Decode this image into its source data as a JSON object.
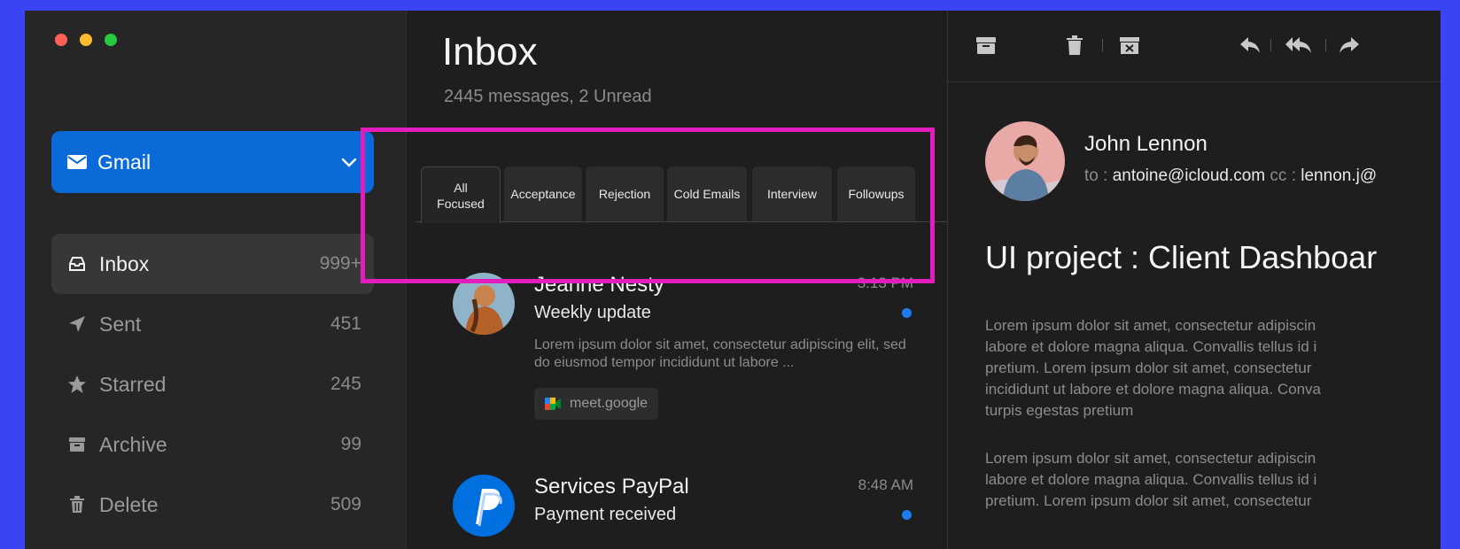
{
  "colors": {
    "background": "#3a44f5",
    "accent": "#0a6bd8",
    "unread_dot": "#1f7bf2",
    "highlight": "#e21dbb"
  },
  "sidebar": {
    "account": {
      "label": "Gmail",
      "icon": "mail-icon"
    },
    "items": [
      {
        "label": "Inbox",
        "count": "999+",
        "icon": "inbox-icon",
        "active": true
      },
      {
        "label": "Sent",
        "count": "451",
        "icon": "send-icon"
      },
      {
        "label": "Starred",
        "count": "245",
        "icon": "star-icon"
      },
      {
        "label": "Archive",
        "count": "99",
        "icon": "archive-icon"
      },
      {
        "label": "Delete",
        "count": "509",
        "icon": "trash-icon"
      }
    ]
  },
  "list": {
    "title": "Inbox",
    "subtitle": "2445 messages, 2 Unread",
    "tabs": [
      {
        "label": "All\nFocused",
        "active": true
      },
      {
        "label": "Acceptance"
      },
      {
        "label": "Rejection"
      },
      {
        "label": "Cold Emails"
      },
      {
        "label": "Interview"
      },
      {
        "label": "Followups"
      }
    ],
    "messages": [
      {
        "sender": "Jeanne Nesty",
        "time": "3:13 PM",
        "subject": "Weekly update",
        "preview": "Lorem ipsum dolor sit amet, consectetur adipiscing elit, sed do eiusmod tempor incididunt ut labore ...",
        "chip": "meet.google",
        "unread": true
      },
      {
        "sender": "Services PayPal",
        "time": "8:48 AM",
        "subject": "Payment received",
        "unread": true
      }
    ]
  },
  "reader": {
    "toolbar": [
      "archive-icon",
      "trash-icon",
      "junk-icon",
      "reply-icon",
      "reply-all-icon",
      "forward-icon"
    ],
    "sender": "John Lennon",
    "to_label": "to : ",
    "to_value": "antoine@icloud.com",
    "cc_label": " cc : ",
    "cc_value": "lennon.j@",
    "title": "UI project : Client Dashboar",
    "para1": "Lorem ipsum dolor sit amet, consectetur adipiscin\nlabore et dolore magna aliqua. Convallis tellus id i\npretium. Lorem ipsum dolor sit amet, consectetur\nincididunt ut labore et dolore magna aliqua. Conva\nturpis egestas pretium",
    "para2": "Lorem ipsum dolor sit amet, consectetur adipiscin\nlabore et dolore magna aliqua. Convallis tellus id i\npretium. Lorem ipsum dolor sit amet, consectetur"
  }
}
